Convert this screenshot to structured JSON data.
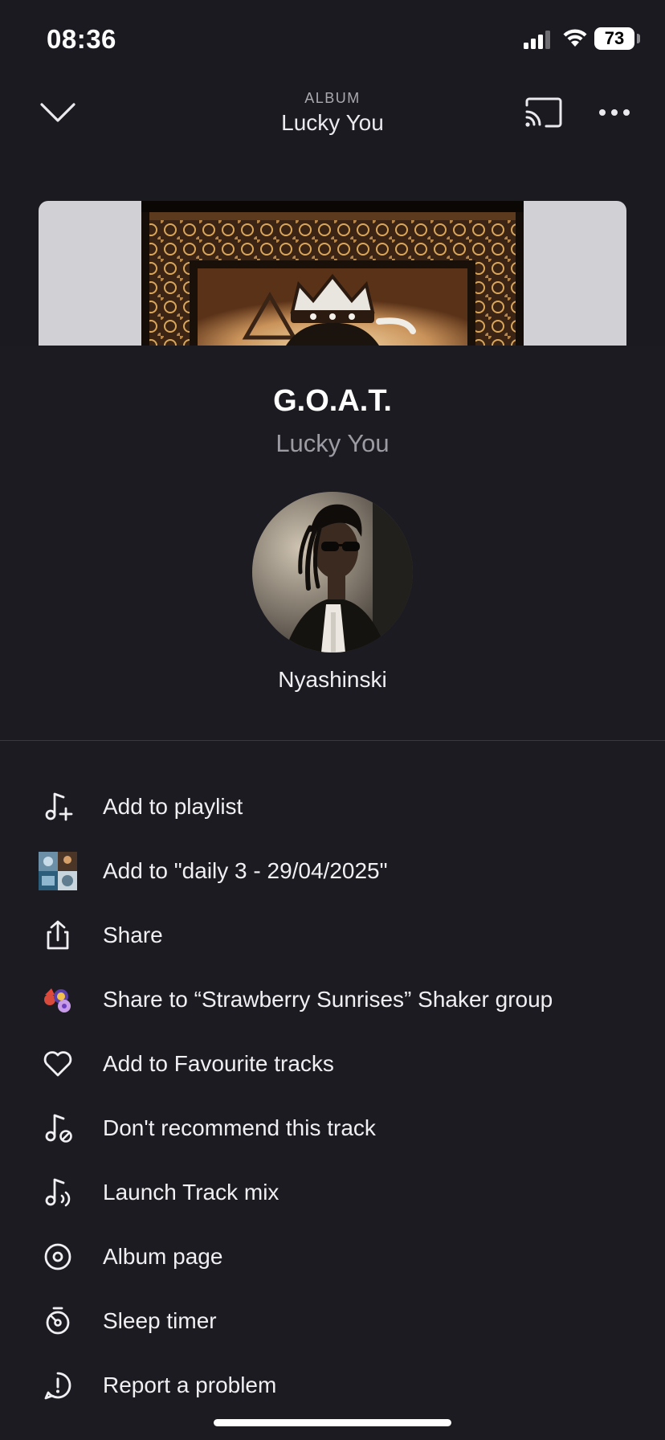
{
  "status_bar": {
    "time": "08:36",
    "battery": "73"
  },
  "header": {
    "eyebrow": "ALBUM",
    "title": "Lucky You"
  },
  "track": {
    "title": "G.O.A.T.",
    "album": "Lucky You",
    "artist": "Nyashinski"
  },
  "menu": [
    {
      "label": "Add to playlist",
      "icon": "add-to-playlist-icon"
    },
    {
      "label": "Add to \"daily 3 - 29/04/2025\"",
      "icon": "playlist-thumbnail"
    },
    {
      "label": "Share",
      "icon": "share-icon"
    },
    {
      "label": "Share to “Strawberry Sunrises” Shaker group",
      "icon": "group-avatar"
    },
    {
      "label": "Add to Favourite tracks",
      "icon": "heart-icon"
    },
    {
      "label": "Don't recommend this track",
      "icon": "dont-recommend-icon"
    },
    {
      "label": "Launch Track mix",
      "icon": "track-mix-icon"
    },
    {
      "label": "Album page",
      "icon": "album-icon"
    },
    {
      "label": "Sleep timer",
      "icon": "sleep-timer-icon"
    },
    {
      "label": "Report a problem",
      "icon": "report-icon"
    }
  ],
  "colors": {
    "background": "#1c1b21",
    "text": "#f0f0f3",
    "secondary_text": "#9c9ba3",
    "divider": "#3a3940"
  }
}
